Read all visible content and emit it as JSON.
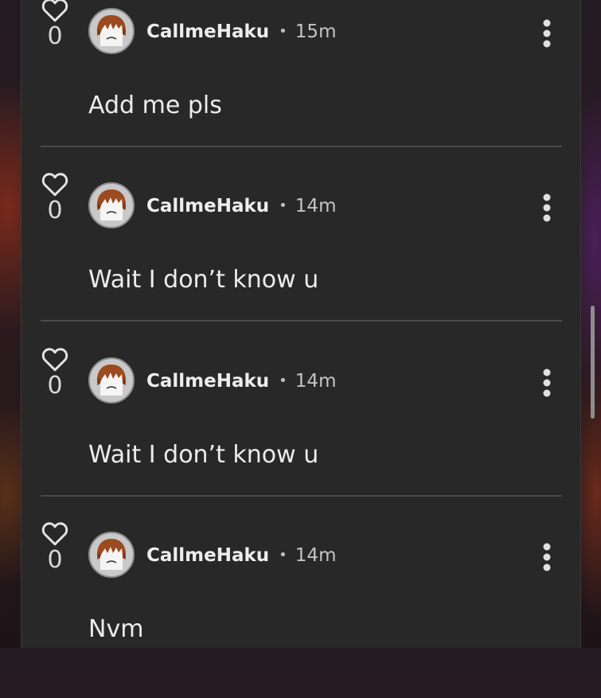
{
  "comments": [
    {
      "likes": "0",
      "username": "CallmeHaku",
      "separator": "•",
      "time": "15m",
      "text": "Add me pls"
    },
    {
      "likes": "0",
      "username": "CallmeHaku",
      "separator": "•",
      "time": "14m",
      "text": "Wait I don’t know u"
    },
    {
      "likes": "0",
      "username": "CallmeHaku",
      "separator": "•",
      "time": "14m",
      "text": "Wait I don’t know u"
    },
    {
      "likes": "0",
      "username": "CallmeHaku",
      "separator": "•",
      "time": "14m",
      "text": "Nvm"
    }
  ],
  "icons": {
    "like": "heart-outline-icon",
    "more": "more-vertical-icon",
    "avatar": "roblox-avatar"
  },
  "colors": {
    "panel_background": "#282828",
    "divider": "#4a4a4a",
    "text_primary": "#ececec",
    "text_secondary": "#c4c4c4"
  }
}
